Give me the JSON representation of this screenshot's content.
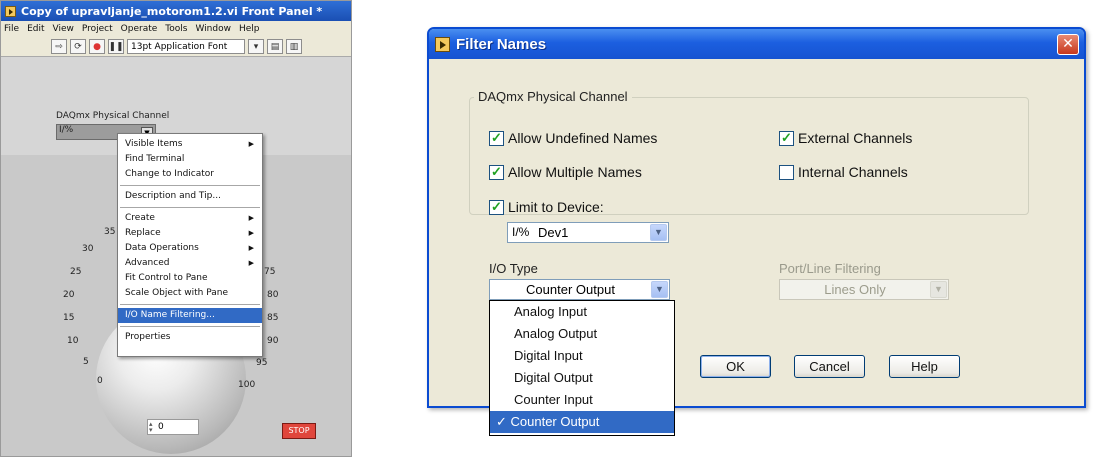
{
  "labview": {
    "title": "Copy of upravljanje_motorom1.2.vi Front Panel *",
    "menu": [
      "File",
      "Edit",
      "View",
      "Project",
      "Operate",
      "Tools",
      "Window",
      "Help"
    ],
    "toolbar_font": "13pt Application Font",
    "daq_label": "DAQmx Physical Channel",
    "knob_ticks": [
      "35",
      "30",
      "25",
      "20",
      "15",
      "10",
      "5",
      "0",
      "75",
      "80",
      "85",
      "90",
      "95",
      "100"
    ],
    "numeric_value": "0",
    "stop_label": "stop",
    "stop_button": "STOP"
  },
  "context_menu": {
    "items": [
      {
        "label": "Visible Items"
      },
      {
        "label": "Find Terminal"
      },
      {
        "label": "Change to Indicator"
      },
      {
        "label": "Description and Tip..."
      },
      {
        "label": "Create"
      },
      {
        "label": "Replace"
      },
      {
        "label": "Data Operations"
      },
      {
        "label": "Advanced"
      },
      {
        "label": "Fit Control to Pane"
      },
      {
        "label": "Scale Object with Pane"
      },
      {
        "label": "I/O Name Filtering..."
      },
      {
        "label": "Properties"
      }
    ]
  },
  "dialog": {
    "title": "Filter Names",
    "group_label": "DAQmx Physical Channel",
    "checkboxes": {
      "allow_undefined": {
        "label": "Allow Undefined Names",
        "checked": true
      },
      "allow_multiple": {
        "label": "Allow Multiple Names",
        "checked": true
      },
      "limit_device": {
        "label": "Limit to Device:",
        "checked": true
      },
      "external": {
        "label": "External Channels",
        "checked": true
      },
      "internal": {
        "label": "Internal Channels",
        "checked": false
      }
    },
    "device_value": "Dev1",
    "io_type_label": "I/O Type",
    "io_type_value": "Counter Output",
    "port_label": "Port/Line Filtering",
    "port_value": "Lines Only",
    "io_options": [
      "Analog Input",
      "Analog Output",
      "Digital Input",
      "Digital Output",
      "Counter Input",
      "Counter Output"
    ],
    "selected_option": "Counter Output",
    "buttons": {
      "ok": "OK",
      "cancel": "Cancel",
      "help": "Help"
    }
  },
  "colors": {
    "selection": "#316ac5",
    "stop": "#e0463c",
    "title_blue": "#1c5fe0"
  }
}
